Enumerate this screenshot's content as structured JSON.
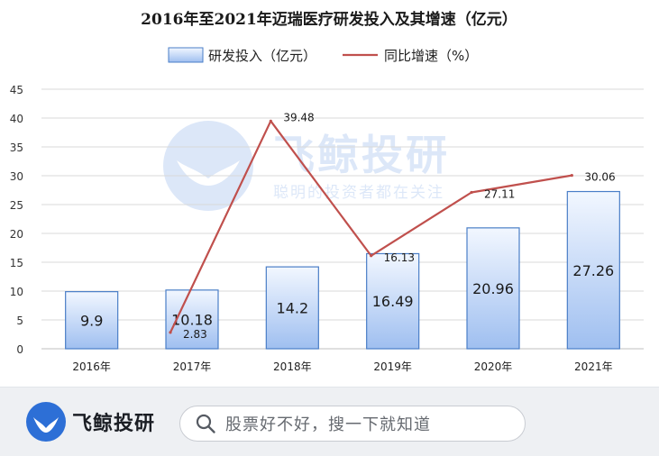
{
  "chart_data": {
    "type": "bar+line",
    "title": "2016年至2021年迈瑞医疗研发投入及其增速（亿元）",
    "categories": [
      "2016年",
      "2017年",
      "2018年",
      "2019年",
      "2020年",
      "2021年"
    ],
    "series": [
      {
        "name": "研发投入（亿元）",
        "kind": "bar",
        "values": [
          9.9,
          10.18,
          14.2,
          16.49,
          20.96,
          27.26
        ]
      },
      {
        "name": "同比增速（%）",
        "kind": "line",
        "values": [
          null,
          2.83,
          39.48,
          16.13,
          27.11,
          30.06
        ]
      }
    ],
    "bar_labels": [
      "9.9",
      "10.18",
      "14.2",
      "16.49",
      "20.96",
      "27.26"
    ],
    "line_labels": [
      "",
      "2.83",
      "39.48",
      "16.13",
      "27.11",
      "30.06"
    ],
    "yticks": [
      0,
      5,
      10,
      15,
      20,
      25,
      30,
      35,
      40,
      45
    ],
    "ylim": [
      0,
      45
    ],
    "grid": true,
    "legend_position": "top-center",
    "colors": {
      "bar_fill_top": "#f2f7ff",
      "bar_fill_bottom": "#9fbff0",
      "bar_stroke": "#4a7ec7",
      "line": "#c0504d",
      "grid": "#d9d9d9"
    }
  },
  "watermark": {
    "brand": "飞鲸投研",
    "slogan": "聪明的投资者都在关注"
  },
  "footer": {
    "brand": "飞鲸投研",
    "search_placeholder": "股票好不好，搜一下就知道"
  }
}
